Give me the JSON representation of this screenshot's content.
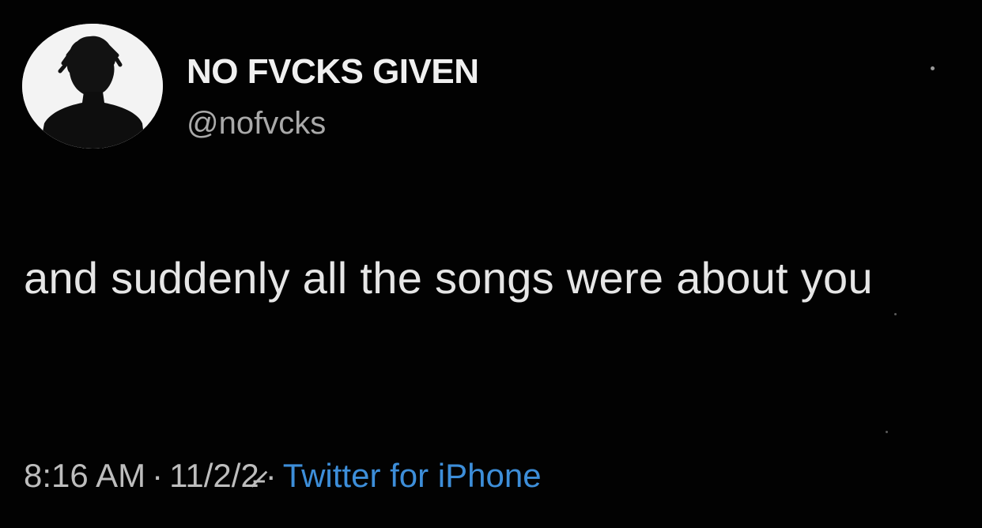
{
  "author": {
    "display_name": "NO FVCKS GIVEN",
    "handle": "@nofvcks"
  },
  "tweet": {
    "text": "and suddenly all the songs were about you"
  },
  "meta": {
    "time": "8:16 AM",
    "separator": "·",
    "date": "11/2/2̷̵",
    "source": "Twitter for iPhone"
  },
  "colors": {
    "background": "#020202",
    "text": "#e6e6e6",
    "secondary": "#a9a9a9",
    "link": "#3d8ed9"
  },
  "icons": {
    "avatar": "silhouette-avatar-icon",
    "menu": "more-dot-icon"
  }
}
